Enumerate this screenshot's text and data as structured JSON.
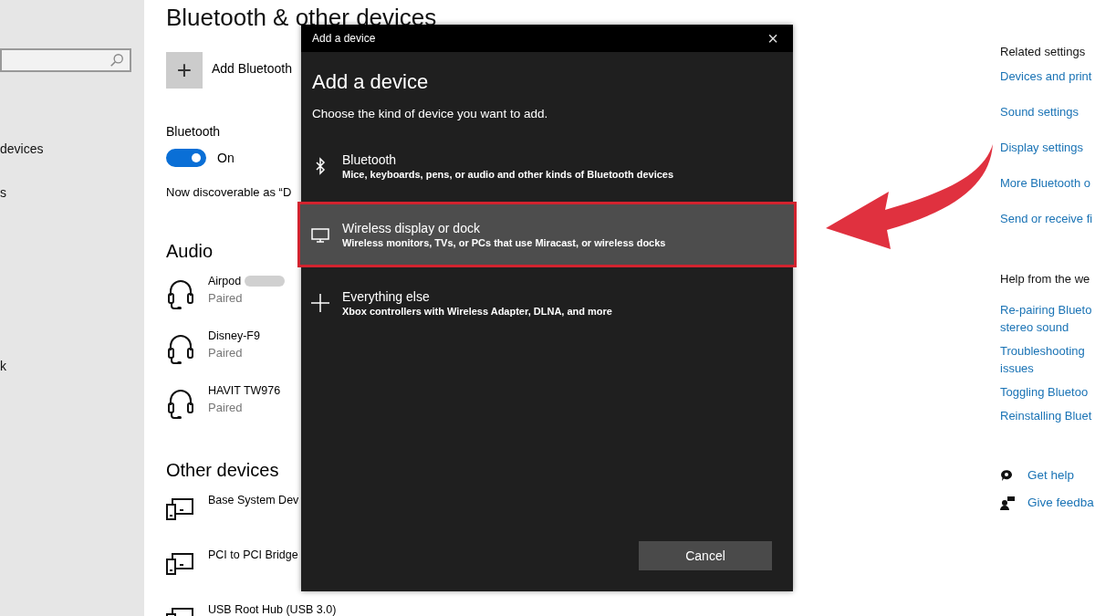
{
  "sidebar": {
    "items": [
      {
        "label": "devices"
      },
      {
        "label": "s"
      },
      {
        "label": "k"
      }
    ]
  },
  "main": {
    "title": "Bluetooth & other devices",
    "add_label": "Add Bluetooth",
    "add_icon": "+",
    "bluetooth": {
      "label": "Bluetooth",
      "on": true,
      "state_text": "On"
    },
    "discoverable": "Now discoverable as “D",
    "sections": [
      {
        "heading": "Audio",
        "devices": [
          {
            "kind": "headset",
            "name": "Airpod",
            "status": "Paired",
            "redacted": true
          },
          {
            "kind": "headset",
            "name": "Disney-F9",
            "status": "Paired"
          },
          {
            "kind": "headset",
            "name": "HAVIT TW976",
            "status": "Paired"
          }
        ]
      },
      {
        "heading": "Other devices",
        "devices": [
          {
            "kind": "device",
            "name": "Base System Dev"
          },
          {
            "kind": "device",
            "name": "PCI to PCI Bridge"
          },
          {
            "kind": "device",
            "name": "USB Root Hub (USB 3.0)"
          }
        ]
      }
    ]
  },
  "related": {
    "heading": "Related settings",
    "links": [
      "Devices and print",
      "Sound settings",
      "Display settings",
      "More Bluetooth o",
      "Send or receive fi"
    ],
    "help_heading": "Help from the we",
    "help_links": [
      "Re-pairing Blueto\nstereo sound",
      "Troubleshooting\nissues",
      "Toggling Bluetoo",
      "Reinstalling Bluet"
    ],
    "footer": [
      {
        "kind": "help",
        "label": "Get help"
      },
      {
        "kind": "feedback",
        "label": "Give feedba"
      }
    ]
  },
  "dialog": {
    "window_title": "Add a device",
    "close": "×",
    "heading": "Add a device",
    "subtitle": "Choose the kind of device you want to add.",
    "options": [
      {
        "kind": "bluetooth",
        "title": "Bluetooth",
        "description": "Mice, keyboards, pens, or audio and other kinds of Bluetooth devices",
        "selected": false
      },
      {
        "kind": "display",
        "title": "Wireless display or dock",
        "description": "Wireless monitors, TVs, or PCs that use Miracast, or wireless docks",
        "selected": true
      },
      {
        "kind": "plus",
        "title": "Everything else",
        "description": "Xbox controllers with Wireless Adapter, DLNA, and more",
        "selected": false
      }
    ],
    "cancel": "Cancel"
  }
}
